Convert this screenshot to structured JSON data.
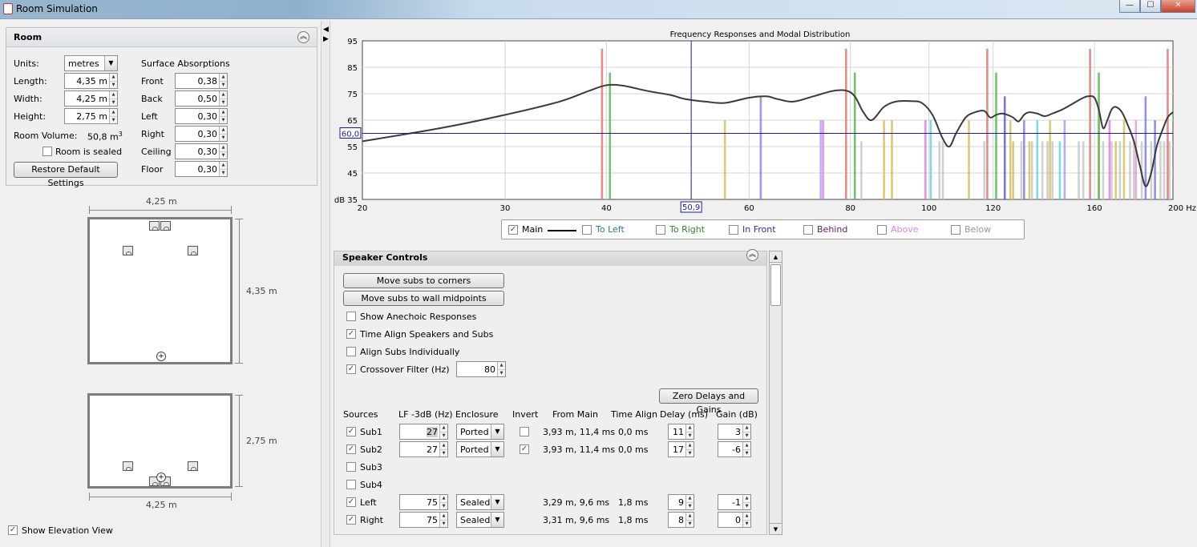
{
  "window": {
    "title": "Room Simulation",
    "buttons": {
      "minimize": "—",
      "maximize": "☐",
      "close": "✕"
    }
  },
  "room": {
    "header": "Room",
    "units_label": "Units:",
    "units_value": "metres",
    "length_label": "Length:",
    "length_value": "4,35 m",
    "width_label": "Width:",
    "width_value": "4,25 m",
    "height_label": "Height:",
    "height_value": "2,75 m",
    "volume_label": "Room Volume:",
    "volume_value": "50,8 m",
    "volume_sup": "3",
    "sealed_label": "Room is sealed",
    "sealed_checked": false,
    "restore_button": "Restore Default Settings",
    "absorptions_title": "Surface Absorptions",
    "surfaces": [
      {
        "label": "Front",
        "value": "0,38"
      },
      {
        "label": "Back",
        "value": "0,50"
      },
      {
        "label": "Left",
        "value": "0,30"
      },
      {
        "label": "Right",
        "value": "0,30"
      },
      {
        "label": "Ceiling",
        "value": "0,30"
      },
      {
        "label": "Floor",
        "value": "0,30"
      }
    ]
  },
  "diagram": {
    "plan_width": "4,25 m",
    "plan_length": "4,35 m",
    "elev_height": "2,75 m",
    "elev_width": "4,25 m",
    "show_elevation_label": "Show Elevation View",
    "show_elevation_checked": true
  },
  "chart_data": {
    "type": "bar",
    "title": "Frequency Responses and Modal Distribution",
    "ylabel": "dB",
    "xlabel": "Hz",
    "x_scale": "log",
    "xlim": [
      20,
      200
    ],
    "ylim": [
      35,
      95
    ],
    "y_ticks": [
      35,
      45,
      55,
      65,
      75,
      85,
      95
    ],
    "x_ticks": [
      20,
      30,
      40,
      60,
      80,
      100,
      120,
      160,
      200
    ],
    "cursor_x": "50,9",
    "cursor_y": "60,0",
    "grid": true,
    "series": [
      {
        "name": "Main",
        "type": "line",
        "color": "#3a3a3a",
        "x": [
          20,
          25,
          30,
          35,
          38,
          40,
          42,
          45,
          48,
          50,
          53,
          56,
          60,
          63,
          65,
          68,
          72,
          76,
          79,
          81,
          83,
          85,
          88,
          91,
          95,
          98,
          101,
          104,
          106,
          108,
          111,
          114,
          117,
          119,
          121,
          123,
          125,
          127,
          129,
          131,
          133,
          136,
          139,
          142,
          146,
          150,
          154,
          157,
          160,
          162,
          164,
          166,
          168,
          170,
          173,
          176,
          179,
          182,
          185,
          188,
          191,
          194,
          197,
          200
        ],
        "y": [
          57,
          62,
          67,
          72,
          76,
          78.2,
          78,
          76,
          74.5,
          73,
          72,
          71.5,
          73.5,
          74,
          73,
          72,
          74,
          76,
          76.2,
          74,
          68,
          65,
          70,
          72,
          72.2,
          71.5,
          67,
          58,
          55,
          60,
          66,
          68,
          68.5,
          66,
          67,
          67.5,
          67,
          66,
          64.5,
          67,
          68,
          67.5,
          66.5,
          67.5,
          69,
          71,
          73,
          74,
          73.5,
          69,
          62,
          65,
          69,
          70,
          68,
          63,
          57,
          48,
          40,
          45,
          55,
          61,
          66,
          68
        ]
      },
      {
        "name": "Modes",
        "type": "bar",
        "unit": "dB",
        "axial": [
          {
            "x": 39.5,
            "y": 92,
            "c": "#e07878"
          },
          {
            "x": 40.4,
            "y": 83,
            "c": "#5cb85c"
          },
          {
            "x": 79,
            "y": 92,
            "c": "#e07878"
          },
          {
            "x": 81,
            "y": 83,
            "c": "#5cb85c"
          },
          {
            "x": 118,
            "y": 92,
            "c": "#e07878"
          },
          {
            "x": 121,
            "y": 83,
            "c": "#5cb85c"
          },
          {
            "x": 158,
            "y": 92,
            "c": "#e07878"
          },
          {
            "x": 162,
            "y": 83,
            "c": "#5cb85c"
          },
          {
            "x": 197,
            "y": 92,
            "c": "#e07878"
          }
        ],
        "tangential": [
          {
            "x": 56,
            "y": 65,
            "c": "#d8c060"
          },
          {
            "x": 62,
            "y": 74,
            "c": "#8a8ae0"
          },
          {
            "x": 73.5,
            "y": 65,
            "c": "#a8a8ff"
          },
          {
            "x": 74,
            "y": 65,
            "c": "#e080e0"
          },
          {
            "x": 88,
            "y": 65,
            "c": "#d8c060"
          },
          {
            "x": 90,
            "y": 65,
            "c": "#d8c060"
          },
          {
            "x": 99,
            "y": 65,
            "c": "#e080e0"
          },
          {
            "x": 100.5,
            "y": 65,
            "c": "#70d0e0"
          },
          {
            "x": 112,
            "y": 65,
            "c": "#d8c060"
          },
          {
            "x": 124,
            "y": 74,
            "c": "#6060d0"
          },
          {
            "x": 126,
            "y": 65,
            "c": "#d8c060"
          },
          {
            "x": 131,
            "y": 65,
            "c": "#8080e0"
          },
          {
            "x": 136,
            "y": 65,
            "c": "#70d0e0"
          },
          {
            "x": 141,
            "y": 65,
            "c": "#d8c060"
          },
          {
            "x": 147,
            "y": 65,
            "c": "#a0a0ff"
          },
          {
            "x": 162,
            "y": 65,
            "c": "#d8c060"
          },
          {
            "x": 167,
            "y": 65,
            "c": "#e080e0"
          },
          {
            "x": 174,
            "y": 65,
            "c": "#d8c060"
          },
          {
            "x": 180,
            "y": 65,
            "c": "#e0a0d0"
          },
          {
            "x": 185,
            "y": 74,
            "c": "#8080e0"
          },
          {
            "x": 190,
            "y": 65,
            "c": "#8080e0"
          }
        ],
        "oblique": [
          {
            "x": 82.5,
            "y": 57,
            "c": "#c8c8c8"
          },
          {
            "x": 103,
            "y": 57,
            "c": "#c8c8c8"
          },
          {
            "x": 104,
            "y": 57,
            "c": "#c8c8c8"
          },
          {
            "x": 117,
            "y": 57,
            "c": "#c8c8c8"
          },
          {
            "x": 127,
            "y": 57,
            "c": "#d8c060"
          },
          {
            "x": 130,
            "y": 57,
            "c": "#c8c8c8"
          },
          {
            "x": 133,
            "y": 57,
            "c": "#d8c060"
          },
          {
            "x": 134,
            "y": 57,
            "c": "#c8c8c8"
          },
          {
            "x": 138,
            "y": 57,
            "c": "#c8c8c8"
          },
          {
            "x": 140,
            "y": 57,
            "c": "#c8c8c8"
          },
          {
            "x": 142,
            "y": 57,
            "c": "#c8c8c8"
          },
          {
            "x": 145,
            "y": 57,
            "c": "#70d0e0"
          },
          {
            "x": 153,
            "y": 57,
            "c": "#c8c8c8"
          },
          {
            "x": 155,
            "y": 57,
            "c": "#c8c8c8"
          },
          {
            "x": 164,
            "y": 57,
            "c": "#c8c8c8"
          },
          {
            "x": 168,
            "y": 57,
            "c": "#c8c8c8"
          },
          {
            "x": 170,
            "y": 57,
            "c": "#d8c060"
          },
          {
            "x": 172,
            "y": 57,
            "c": "#c8c8c8"
          },
          {
            "x": 177,
            "y": 57,
            "c": "#c8c8c8"
          },
          {
            "x": 179,
            "y": 57,
            "c": "#c8c8c8"
          },
          {
            "x": 183,
            "y": 57,
            "c": "#c8c8c8"
          },
          {
            "x": 188,
            "y": 57,
            "c": "#c8c8c8"
          },
          {
            "x": 193,
            "y": 57,
            "c": "#c8c8c8"
          },
          {
            "x": 195,
            "y": 57,
            "c": "#c8c8c8"
          },
          {
            "x": 198,
            "y": 57,
            "c": "#c8c8c8"
          }
        ]
      }
    ]
  },
  "legend": [
    {
      "label": "Main",
      "checked": true,
      "color": "#000000",
      "line": true
    },
    {
      "label": "To Left",
      "checked": false,
      "color": "#2a7f8a"
    },
    {
      "label": "To Right",
      "checked": false,
      "color": "#2e8b2e"
    },
    {
      "label": "In Front",
      "checked": false,
      "color": "#2233aa"
    },
    {
      "label": "Behind",
      "checked": false,
      "color": "#6a1a6a"
    },
    {
      "label": "Above",
      "checked": false,
      "color": "#e080e0"
    },
    {
      "label": "Below",
      "checked": false,
      "color": "#999999"
    }
  ],
  "speaker_controls": {
    "header": "Speaker Controls",
    "move_corners": "Move subs to corners",
    "move_midpoints": "Move subs to wall midpoints",
    "anechoic_label": "Show Anechoic Responses",
    "anechoic_checked": false,
    "time_align_label": "Time Align Speakers and Subs",
    "time_align_checked": true,
    "align_subs_label": "Align Subs Individually",
    "align_subs_checked": false,
    "crossover_label": "Crossover Filter (Hz)",
    "crossover_checked": true,
    "crossover_value": "80",
    "zero_button": "Zero Delays and Gains",
    "columns": [
      "Sources",
      "LF -3dB (Hz)",
      "Enclosure",
      "Invert",
      "From Main",
      "Time Align",
      "Delay (ms)",
      "Gain (dB)"
    ],
    "rows": [
      {
        "name": "Sub1",
        "checked": true,
        "lf": "27",
        "enclosure": "Ported",
        "invert": false,
        "show_invert": true,
        "from_main": "3,93 m, 11,4 ms",
        "time_align": "0,0 ms",
        "delay": "11",
        "gain": "3",
        "focused": true
      },
      {
        "name": "Sub2",
        "checked": true,
        "lf": "27",
        "enclosure": "Ported",
        "invert": true,
        "show_invert": true,
        "from_main": "3,93 m, 11,4 ms",
        "time_align": "0,0 ms",
        "delay": "17",
        "gain": "-6"
      },
      {
        "name": "Sub3",
        "checked": false
      },
      {
        "name": "Sub4",
        "checked": false
      },
      {
        "name": "Left",
        "checked": true,
        "lf": "75",
        "enclosure": "Sealed",
        "show_invert": false,
        "from_main": "3,29 m, 9,6 ms",
        "time_align": "1,8 ms",
        "delay": "9",
        "gain": "-1"
      },
      {
        "name": "Right",
        "checked": true,
        "lf": "75",
        "enclosure": "Sealed",
        "show_invert": false,
        "from_main": "3,31 m, 9,6 ms",
        "time_align": "1,8 ms",
        "delay": "8",
        "gain": "0"
      }
    ]
  }
}
